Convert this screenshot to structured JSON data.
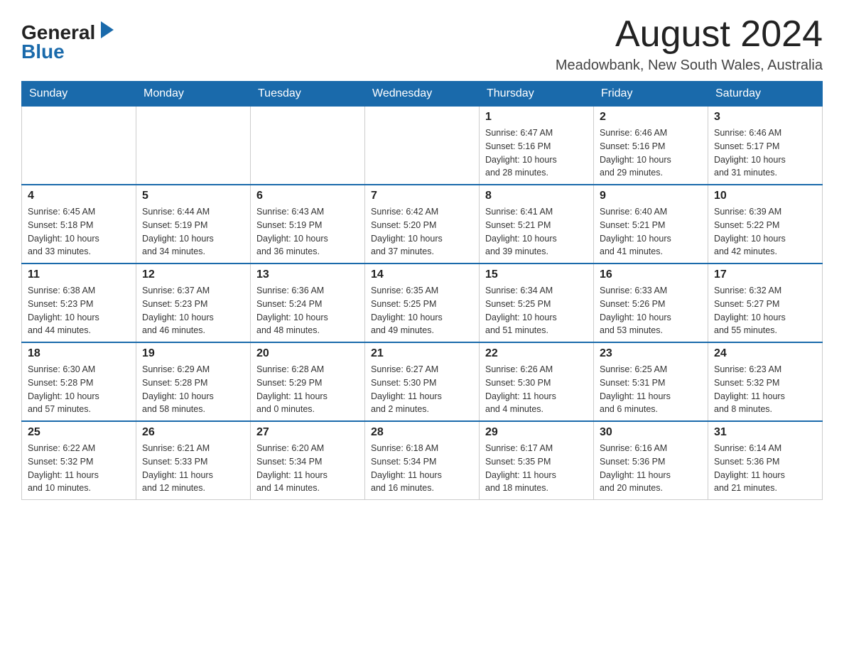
{
  "header": {
    "logo_text_general": "General",
    "logo_text_blue": "Blue",
    "month_title": "August 2024",
    "subtitle": "Meadowbank, New South Wales, Australia"
  },
  "days_of_week": [
    "Sunday",
    "Monday",
    "Tuesday",
    "Wednesday",
    "Thursday",
    "Friday",
    "Saturday"
  ],
  "weeks": [
    [
      {
        "day": "",
        "info": ""
      },
      {
        "day": "",
        "info": ""
      },
      {
        "day": "",
        "info": ""
      },
      {
        "day": "",
        "info": ""
      },
      {
        "day": "1",
        "info": "Sunrise: 6:47 AM\nSunset: 5:16 PM\nDaylight: 10 hours\nand 28 minutes."
      },
      {
        "day": "2",
        "info": "Sunrise: 6:46 AM\nSunset: 5:16 PM\nDaylight: 10 hours\nand 29 minutes."
      },
      {
        "day": "3",
        "info": "Sunrise: 6:46 AM\nSunset: 5:17 PM\nDaylight: 10 hours\nand 31 minutes."
      }
    ],
    [
      {
        "day": "4",
        "info": "Sunrise: 6:45 AM\nSunset: 5:18 PM\nDaylight: 10 hours\nand 33 minutes."
      },
      {
        "day": "5",
        "info": "Sunrise: 6:44 AM\nSunset: 5:19 PM\nDaylight: 10 hours\nand 34 minutes."
      },
      {
        "day": "6",
        "info": "Sunrise: 6:43 AM\nSunset: 5:19 PM\nDaylight: 10 hours\nand 36 minutes."
      },
      {
        "day": "7",
        "info": "Sunrise: 6:42 AM\nSunset: 5:20 PM\nDaylight: 10 hours\nand 37 minutes."
      },
      {
        "day": "8",
        "info": "Sunrise: 6:41 AM\nSunset: 5:21 PM\nDaylight: 10 hours\nand 39 minutes."
      },
      {
        "day": "9",
        "info": "Sunrise: 6:40 AM\nSunset: 5:21 PM\nDaylight: 10 hours\nand 41 minutes."
      },
      {
        "day": "10",
        "info": "Sunrise: 6:39 AM\nSunset: 5:22 PM\nDaylight: 10 hours\nand 42 minutes."
      }
    ],
    [
      {
        "day": "11",
        "info": "Sunrise: 6:38 AM\nSunset: 5:23 PM\nDaylight: 10 hours\nand 44 minutes."
      },
      {
        "day": "12",
        "info": "Sunrise: 6:37 AM\nSunset: 5:23 PM\nDaylight: 10 hours\nand 46 minutes."
      },
      {
        "day": "13",
        "info": "Sunrise: 6:36 AM\nSunset: 5:24 PM\nDaylight: 10 hours\nand 48 minutes."
      },
      {
        "day": "14",
        "info": "Sunrise: 6:35 AM\nSunset: 5:25 PM\nDaylight: 10 hours\nand 49 minutes."
      },
      {
        "day": "15",
        "info": "Sunrise: 6:34 AM\nSunset: 5:25 PM\nDaylight: 10 hours\nand 51 minutes."
      },
      {
        "day": "16",
        "info": "Sunrise: 6:33 AM\nSunset: 5:26 PM\nDaylight: 10 hours\nand 53 minutes."
      },
      {
        "day": "17",
        "info": "Sunrise: 6:32 AM\nSunset: 5:27 PM\nDaylight: 10 hours\nand 55 minutes."
      }
    ],
    [
      {
        "day": "18",
        "info": "Sunrise: 6:30 AM\nSunset: 5:28 PM\nDaylight: 10 hours\nand 57 minutes."
      },
      {
        "day": "19",
        "info": "Sunrise: 6:29 AM\nSunset: 5:28 PM\nDaylight: 10 hours\nand 58 minutes."
      },
      {
        "day": "20",
        "info": "Sunrise: 6:28 AM\nSunset: 5:29 PM\nDaylight: 11 hours\nand 0 minutes."
      },
      {
        "day": "21",
        "info": "Sunrise: 6:27 AM\nSunset: 5:30 PM\nDaylight: 11 hours\nand 2 minutes."
      },
      {
        "day": "22",
        "info": "Sunrise: 6:26 AM\nSunset: 5:30 PM\nDaylight: 11 hours\nand 4 minutes."
      },
      {
        "day": "23",
        "info": "Sunrise: 6:25 AM\nSunset: 5:31 PM\nDaylight: 11 hours\nand 6 minutes."
      },
      {
        "day": "24",
        "info": "Sunrise: 6:23 AM\nSunset: 5:32 PM\nDaylight: 11 hours\nand 8 minutes."
      }
    ],
    [
      {
        "day": "25",
        "info": "Sunrise: 6:22 AM\nSunset: 5:32 PM\nDaylight: 11 hours\nand 10 minutes."
      },
      {
        "day": "26",
        "info": "Sunrise: 6:21 AM\nSunset: 5:33 PM\nDaylight: 11 hours\nand 12 minutes."
      },
      {
        "day": "27",
        "info": "Sunrise: 6:20 AM\nSunset: 5:34 PM\nDaylight: 11 hours\nand 14 minutes."
      },
      {
        "day": "28",
        "info": "Sunrise: 6:18 AM\nSunset: 5:34 PM\nDaylight: 11 hours\nand 16 minutes."
      },
      {
        "day": "29",
        "info": "Sunrise: 6:17 AM\nSunset: 5:35 PM\nDaylight: 11 hours\nand 18 minutes."
      },
      {
        "day": "30",
        "info": "Sunrise: 6:16 AM\nSunset: 5:36 PM\nDaylight: 11 hours\nand 20 minutes."
      },
      {
        "day": "31",
        "info": "Sunrise: 6:14 AM\nSunset: 5:36 PM\nDaylight: 11 hours\nand 21 minutes."
      }
    ]
  ]
}
